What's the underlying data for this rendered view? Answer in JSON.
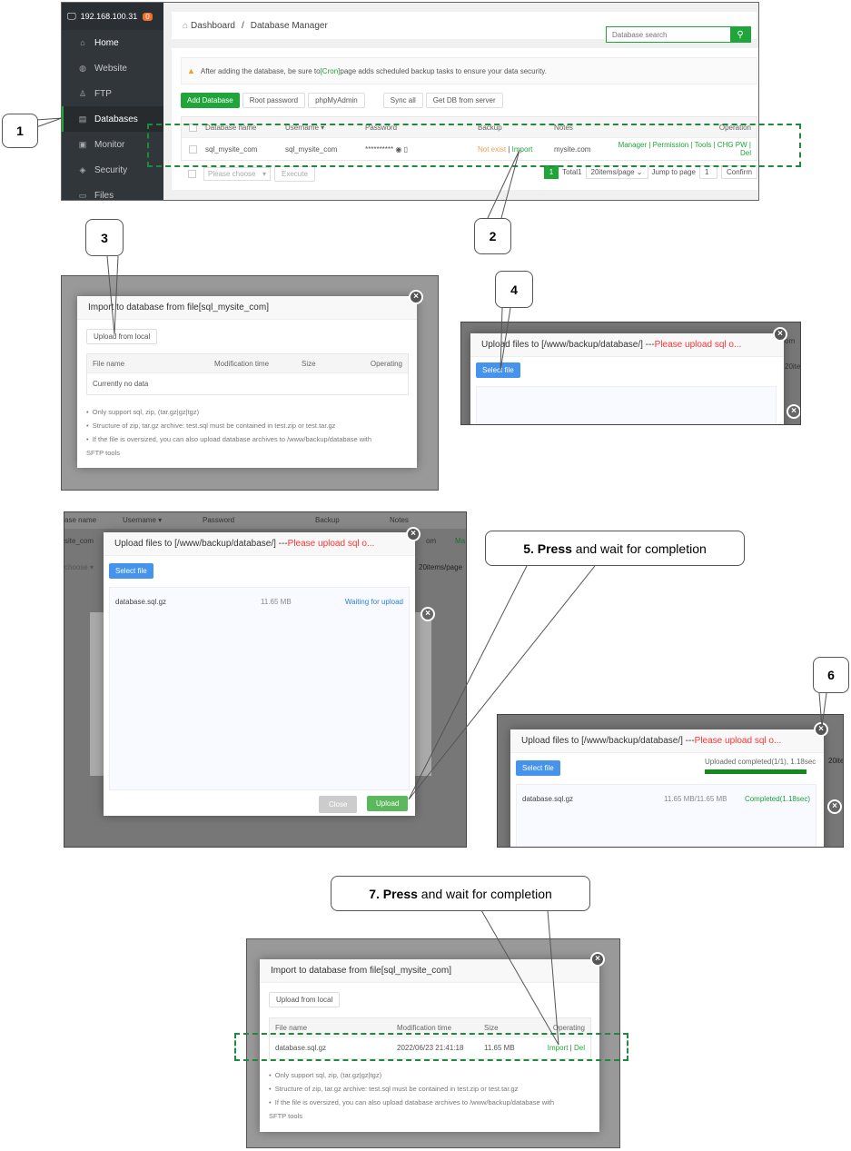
{
  "panel1": {
    "host": "192.168.100.31",
    "notif_count": "0",
    "sidebar": [
      {
        "icon": "home-icon",
        "glyph": "⌂",
        "label": "Home"
      },
      {
        "icon": "globe-icon",
        "glyph": "◍",
        "label": "Website"
      },
      {
        "icon": "ftp-icon",
        "glyph": "♙",
        "label": "FTP"
      },
      {
        "icon": "database-icon",
        "glyph": "▤",
        "label": "Databases"
      },
      {
        "icon": "monitor-icon",
        "glyph": "▣",
        "label": "Monitor"
      },
      {
        "icon": "shield-icon",
        "glyph": "◈",
        "label": "Security"
      },
      {
        "icon": "folder-icon",
        "glyph": "▭",
        "label": "Files"
      }
    ],
    "breadcrumb": {
      "home": "Dashboard",
      "sep": "/",
      "current": "Database Manager"
    },
    "search_placeholder": "Database search",
    "warning": {
      "pre": "After adding the database, be sure to ",
      "link": "[Cron]",
      "post": " page adds scheduled backup tasks to ensure your data security."
    },
    "toolbar": {
      "add": "Add Database",
      "root_pw": "Root password",
      "pma": "phpMyAdmin",
      "sync": "Sync all",
      "get_db": "Get DB from server"
    },
    "columns": {
      "name": "Database name",
      "user": "Username ▾",
      "pw": "Password",
      "backup": "Backup",
      "notes": "Notes",
      "op": "Operation"
    },
    "row": {
      "name": "sql_mysite_com",
      "user": "sql_mysite_com",
      "pw": "**********",
      "backup_status": "Not exist",
      "backup_sep": " | ",
      "import": "Import",
      "notes": "mysite.com",
      "ops": "Manager | Permission | Tools | CHG PW | Del"
    },
    "footer": {
      "choose": "Please choose",
      "execute": "Execute",
      "page": "1",
      "total": "Total1",
      "per_page": "20items/page",
      "jump": "Jump to page",
      "jump_val": "1",
      "confirm": "Confirm"
    }
  },
  "callouts": {
    "c1": "1",
    "c2": "2",
    "c3": "3",
    "c4": "4",
    "c5_bold": "5. Press",
    "c5_rest": " and wait for completion",
    "c6": "6",
    "c7_bold": "7. Press",
    "c7_rest": " and wait for completion"
  },
  "import_dialog": {
    "title": "Import to database from file[sql_mysite_com]",
    "upload_btn": "Upload from local",
    "columns": {
      "name": "File name",
      "mtime": "Modification time",
      "size": "Size",
      "op": "Operating"
    },
    "empty": "Currently no data",
    "notes": [
      "Only support sql, zip, (tar.gz|gz|tgz)",
      "Structure of zip, tar.gz archive: test.sql must be contained in test.zip or test.tar.gz",
      "If the file is oversized, you can also upload database archives to /www/backup/database with",
      "SFTP tools"
    ]
  },
  "upload_dialog": {
    "title": "Upload files to [/www/backup/database/] --- ",
    "title_warn": "Please upload sql o...",
    "select_btn": "Select file",
    "file": "database.sql.gz",
    "size": "11.65 MB",
    "status_wait": "Waiting for upload",
    "close_btn": "Close",
    "upload_btn": "Upload",
    "bg_cols": [
      "ase name",
      "Username ▾",
      "Password",
      "Backup",
      "Notes"
    ],
    "bg_row": [
      "site_com",
      "om",
      "Ma"
    ],
    "bg_foot": [
      "choose ▾",
      "20items/page"
    ],
    "done_status": "Uploaded completed(1/1), 1.18sec",
    "done_progress": 1.0,
    "done_size": "11.65 MB/11.65 MB",
    "done_file_status": "Completed(1.18sec)",
    "bg_right": [
      "om",
      "20ite"
    ]
  },
  "import_final": {
    "file": "database.sql.gz",
    "mtime": "2022/06/23 21:41:18",
    "size": "11.65 MB",
    "import": "Import",
    "sep": " | ",
    "del": "Del"
  }
}
